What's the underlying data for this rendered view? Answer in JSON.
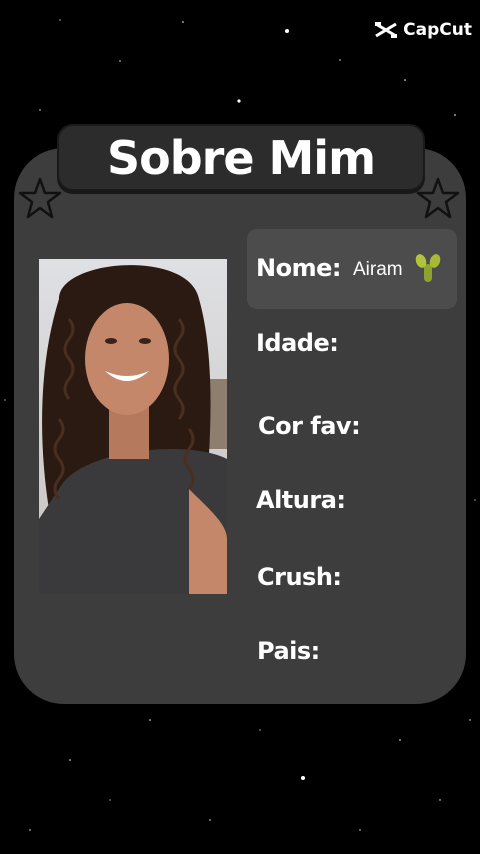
{
  "watermark": {
    "label": "CapCut",
    "icon": "capcut-logo-icon"
  },
  "card": {
    "title": "Sobre Mim",
    "fields": {
      "nome_label": "Nome:",
      "nome_value": "Airam",
      "idade_label": "Idade:",
      "cor_fav_label": "Cor fav:",
      "altura_label": "Altura:",
      "crush_label": "Crush:",
      "pais_label": "Pais:"
    },
    "icons": [
      "star-outline-icon",
      "cactus-emoji-icon"
    ]
  },
  "colors": {
    "background": "#000000",
    "card": "#3d3d3d",
    "title_box": "#2c2c2c",
    "highlight_box": "#4c4c4c",
    "text": "#ffffff"
  }
}
